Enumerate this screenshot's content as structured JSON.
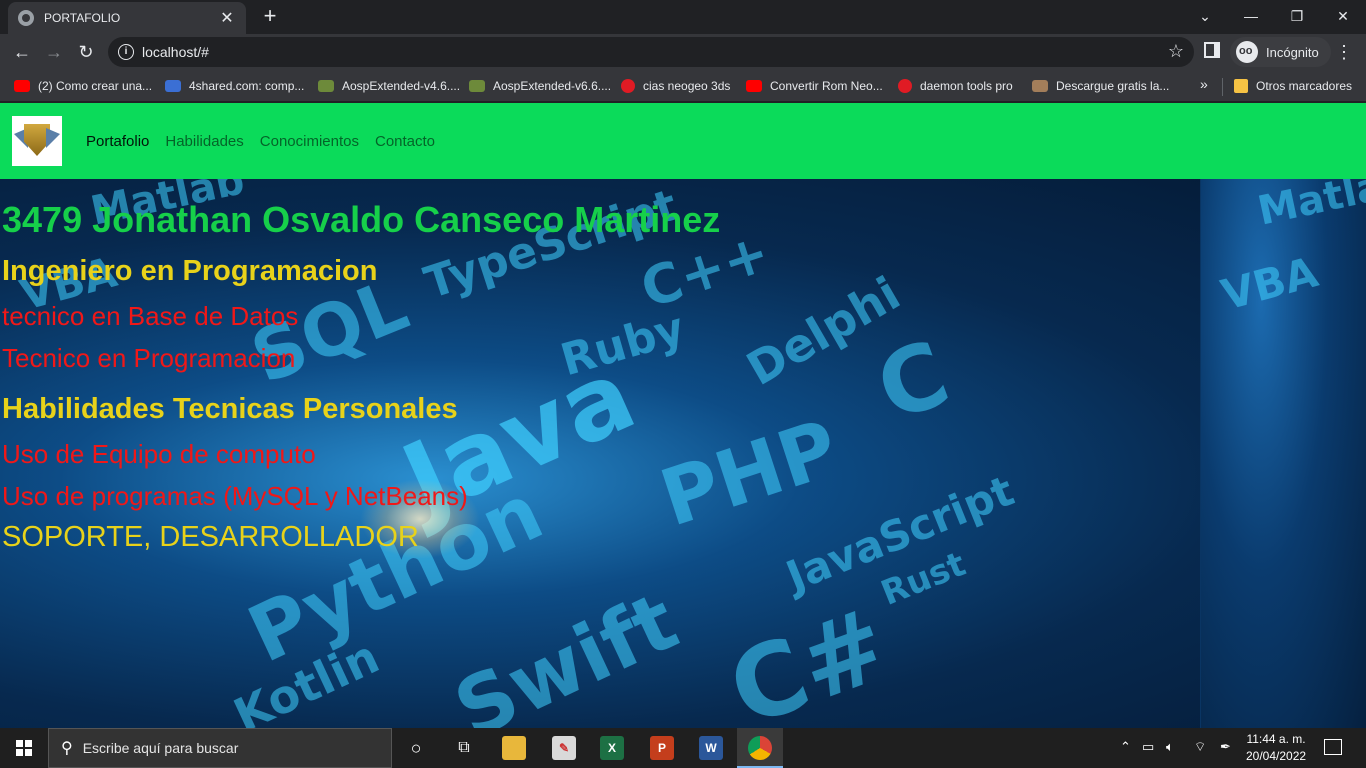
{
  "browser": {
    "tab_title": "PORTAFOLIO",
    "url": "localhost/#",
    "profile_label": "Incógnito",
    "bookmarks": [
      {
        "label": "(2) Como crear una...",
        "icon": "youtube-icon"
      },
      {
        "label": "4shared.com: comp...",
        "icon": "4shared-icon"
      },
      {
        "label": "AospExtended-v4.6....",
        "icon": "aospextended-icon"
      },
      {
        "label": "AospExtended-v6.6....",
        "icon": "aospextended-icon"
      },
      {
        "label": "cias neogeo 3ds",
        "icon": "gmail-icon"
      },
      {
        "label": "Convertir Rom Neo...",
        "icon": "youtube-icon"
      },
      {
        "label": "daemon tools pro",
        "icon": "gmail-icon"
      },
      {
        "label": "Descargue gratis la...",
        "icon": "profile-icon"
      }
    ],
    "other_bookmarks": "Otros marcadores",
    "more_bookmarks": "»"
  },
  "page": {
    "nav": {
      "links": [
        "Portafolio",
        "Habilidades",
        "Conocimientos",
        "Contacto"
      ]
    },
    "hero": {
      "name": "3479 Jonathan Osvaldo Canseco Martinez",
      "role": "Ingeniero en Programacion",
      "lines_red_1": [
        "tecnico en Base de Datos",
        "Tecnico en Programacion"
      ],
      "skills_title": "Habilidades Tecnicas Personales",
      "lines_red_2": [
        "Uso de Equipo de computo",
        "Uso de programas (MySQL y NetBeans)"
      ],
      "footer_line": "SOPORTE, DESARROLLADOR"
    },
    "background_words": [
      "Matlab",
      "TypeScript",
      "VBA",
      "SQL",
      "C++",
      "Ruby",
      "Delphi",
      "Java",
      "C",
      "PHP",
      "Python",
      "JavaScript",
      "Rust",
      "Swift",
      "C#",
      "Kotlin"
    ]
  },
  "taskbar": {
    "search_placeholder": "Escribe aquí para buscar",
    "time": "11:44 a. m.",
    "date": "20/04/2022"
  },
  "colors": {
    "navbar": "#0bdb5a",
    "name": "#16d04a",
    "yellow": "#e8d21a",
    "red": "#f01818"
  }
}
